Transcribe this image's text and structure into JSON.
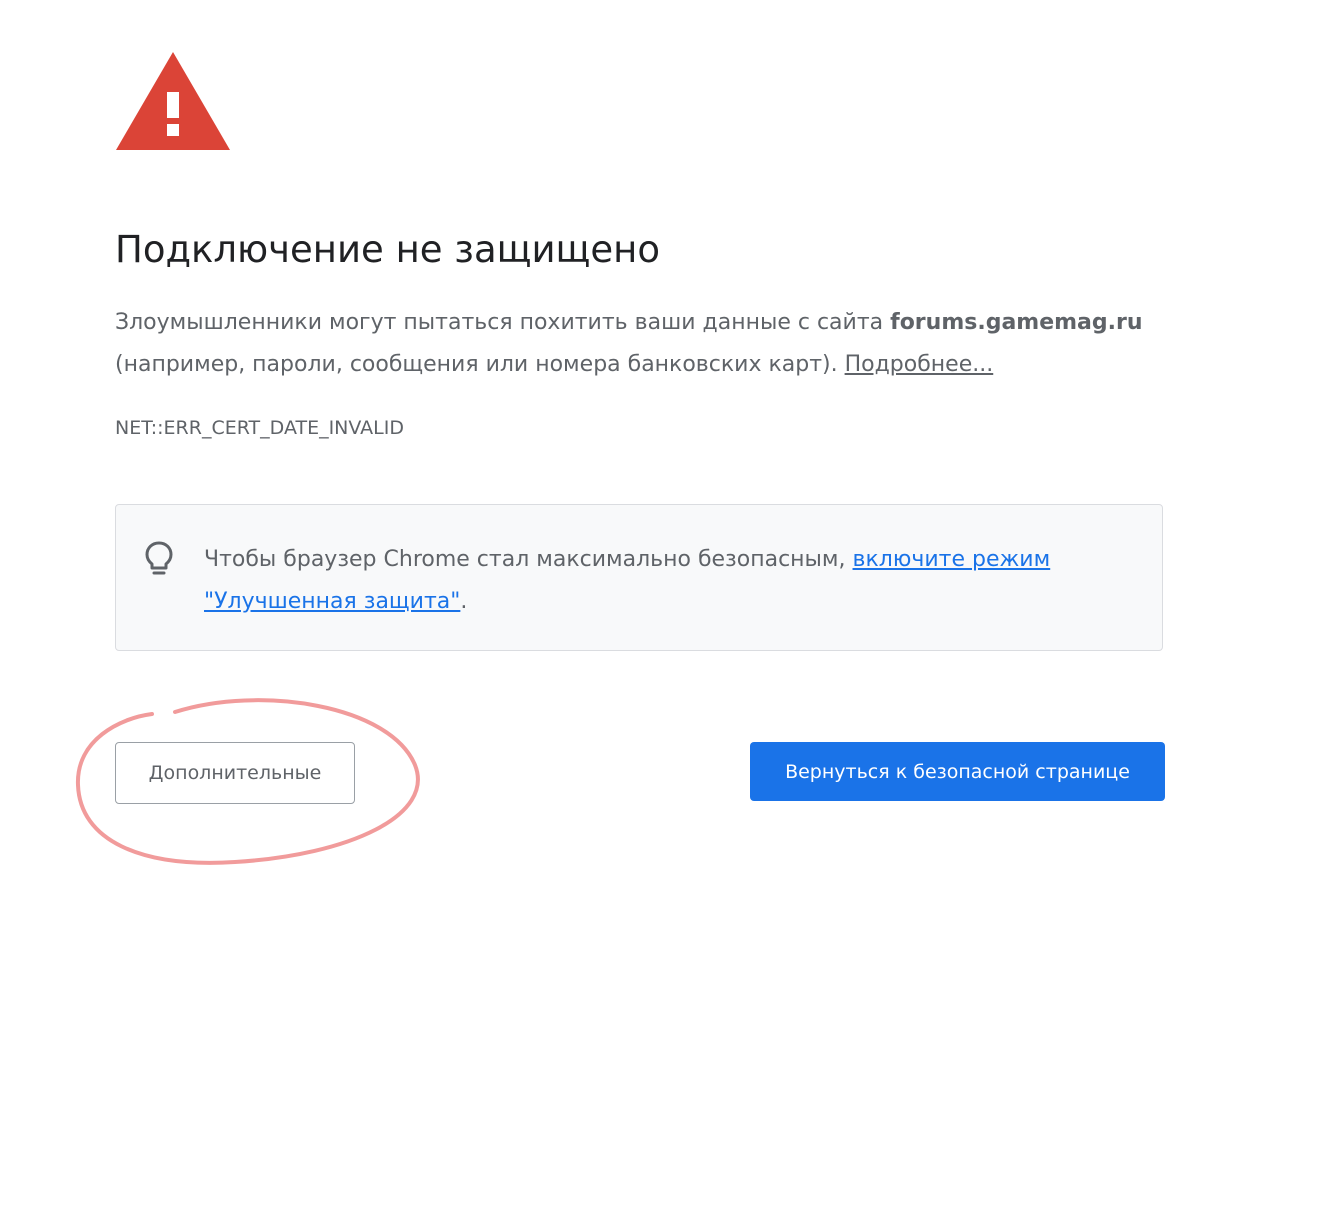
{
  "icons": {
    "warning": "warning-triangle-icon",
    "tip": "lightbulb-icon"
  },
  "colors": {
    "warning_red": "#db4437",
    "link_blue": "#1a73e8",
    "primary_button": "#1a73e8",
    "annotation": "#ef8a8a"
  },
  "header": {
    "title": "Подключение не защищено"
  },
  "message": {
    "text_before": "Злоумышленники могут пытаться похитить ваши данные с сайта ",
    "domain": "forums.gamemag.ru",
    "text_after": " (например, пароли, сообщения или номера банковских карт). ",
    "details_link": "Подробнее..."
  },
  "error_code": "NET::ERR_CERT_DATE_INVALID",
  "tip": {
    "text_before": "Чтобы браузер Chrome стал максимально безопасным, ",
    "link": "включите режим \"Улучшенная защита\"",
    "text_after": "."
  },
  "buttons": {
    "advanced": "Дополнительные",
    "back_to_safety": "Вернуться к безопасной странице"
  }
}
